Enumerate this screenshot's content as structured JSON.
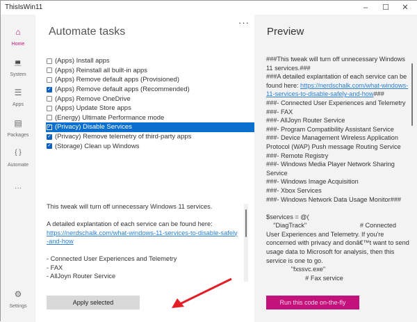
{
  "window": {
    "title": "ThisIsWin11",
    "minimize": "–",
    "maximize": "☐",
    "close": "✕"
  },
  "sidebar": {
    "items": [
      {
        "label": "Home",
        "icon": "⌂"
      },
      {
        "label": "System",
        "icon": "💻"
      },
      {
        "label": "Apps",
        "icon": "☰"
      },
      {
        "label": "Packages",
        "icon": "▤"
      },
      {
        "label": "Automate",
        "icon": "{ }"
      }
    ],
    "more": "···",
    "settings": {
      "label": "Settings",
      "icon": "⚙"
    }
  },
  "main": {
    "title": "Automate tasks",
    "more": "···",
    "tasks": [
      {
        "label": "(Apps) Install apps",
        "checked": false
      },
      {
        "label": "(Apps) Reinstall all built-in apps",
        "checked": false
      },
      {
        "label": "(Apps) Remove default apps (Provisioned)",
        "checked": false
      },
      {
        "label": "(Apps) Remove default apps (Recommended)",
        "checked": true
      },
      {
        "label": "(Apps) Remove OneDrive",
        "checked": false
      },
      {
        "label": "(Apps) Update Store apps",
        "checked": false
      },
      {
        "label": "(Energy) Ultimate Performance mode",
        "checked": false
      },
      {
        "label": "(Privacy) Disable Services",
        "checked": true,
        "selected": true
      },
      {
        "label": "(Privacy) Remove telemetry of third-party apps",
        "checked": true
      },
      {
        "label": "(Storage) Clean up Windows",
        "checked": true
      }
    ],
    "description": {
      "line1": "This tweak will turn off unnecessary Windows 11 services.",
      "line2": "A detailed explantation of each service can be found here:",
      "link": "https://nerdschalk.com/what-windows-11-services-to-disable-safely-and-how",
      "items": [
        "- Connected User Experiences and Telemetry",
        "- FAX",
        "- AllJoyn Router Service"
      ]
    },
    "apply_label": "Apply selected"
  },
  "preview": {
    "title": "Preview",
    "text_before_link": "###This tweak will turn off unnecessary Windows 11 services.###\n###A detailed explantation of each service can be found here: ",
    "link": "https://nerdschalk.com/what-windows-11-services-to-disable-safely-and-how",
    "text_after_link": "###\n###- Connected User Experiences and Telemetry\n###- FAX\n###- AllJoyn Router Service\n###- Program Compatibility Assistant Service\n###- Device Management Wireless Application Protocol (WAP) Push message Routing Service\n###- Remote Registry\n###- Windows Media Player Network Sharing Service\n###- Windows Image Acquisition\n###- Xbox Services\n###- Windows Network Data Usage Monitor###\n\n$services = @(\n    \"DiagTrack\"                              # Connected User Experiences and Telemetry. If you're concerned with privacy and donâ€™t want to send usage data to Microsoft for analysis, then this service is one to go.\n              \"fxssvc.exe\"\n                      # Fax service",
    "run_label": "Run this code on-the-fly"
  }
}
